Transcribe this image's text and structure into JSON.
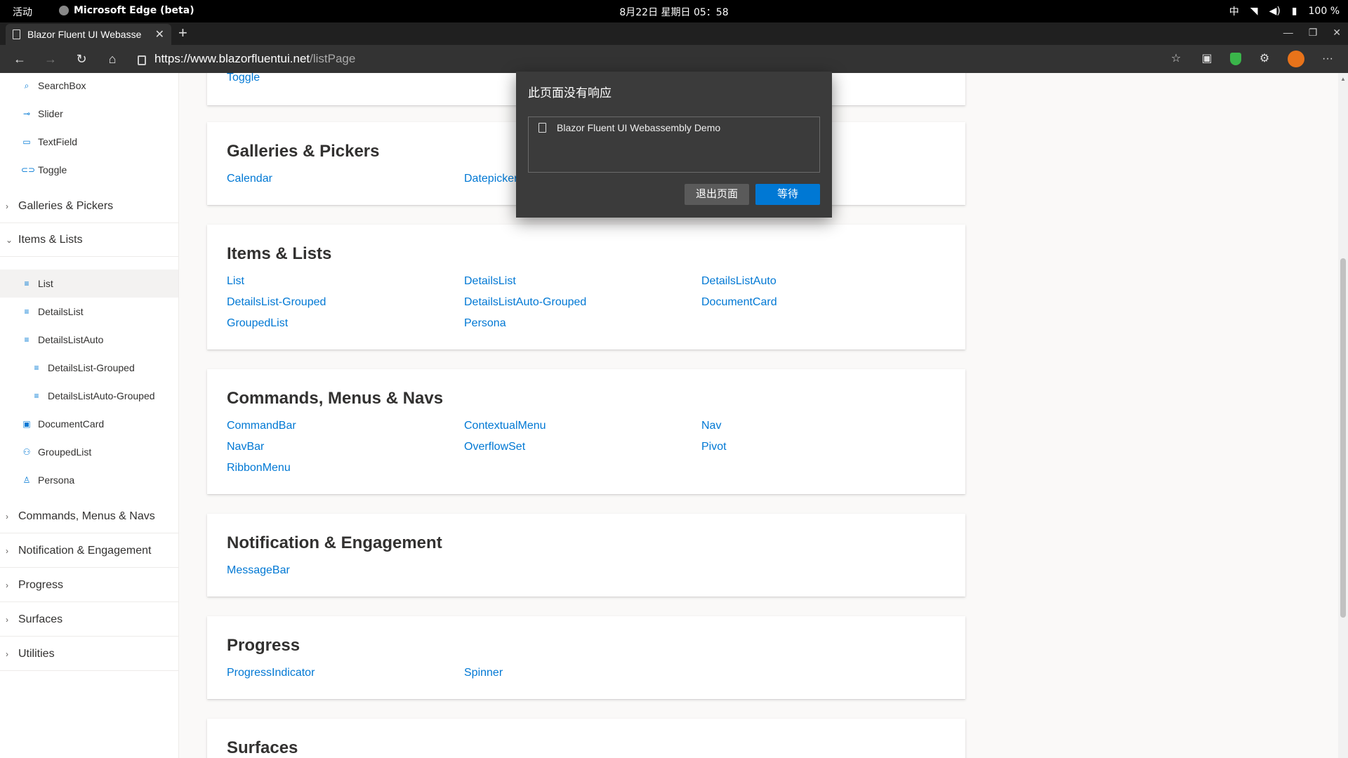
{
  "os_bar": {
    "activities": "活动",
    "app_name": "Microsoft Edge (beta)",
    "clock": "8月22日 星期日 05：58",
    "input_method": "中",
    "battery": "100 %"
  },
  "browser": {
    "tab_title": "Blazor Fluent UI Webasse",
    "url_host": "https://www.blazorfluentui.net",
    "url_path": "/listPage"
  },
  "sidebar": {
    "items_top": [
      {
        "label": "SearchBox",
        "icon": "search-icon",
        "glyph": "⌕"
      },
      {
        "label": "Slider",
        "icon": "slider-icon",
        "glyph": "⊸"
      },
      {
        "label": "TextField",
        "icon": "textfield-icon",
        "glyph": "▭"
      },
      {
        "label": "Toggle",
        "icon": "toggle-icon",
        "glyph": "⊂⊃"
      }
    ],
    "group_galleries": "Galleries & Pickers",
    "group_items": "Items & Lists",
    "items_lists": [
      {
        "label": "List",
        "icon": "list-icon",
        "glyph": "≡"
      },
      {
        "label": "DetailsList",
        "icon": "list-icon",
        "glyph": "≡"
      },
      {
        "label": "DetailsListAuto",
        "icon": "list-icon",
        "glyph": "≡"
      },
      {
        "label": "DetailsList-Grouped",
        "icon": "list-icon",
        "glyph": "≡"
      },
      {
        "label": "DetailsListAuto-Grouped",
        "icon": "list-icon",
        "glyph": "≡"
      },
      {
        "label": "DocumentCard",
        "icon": "document-card-icon",
        "glyph": "▣"
      },
      {
        "label": "GroupedList",
        "icon": "people-icon",
        "glyph": "⚇"
      },
      {
        "label": "Persona",
        "icon": "person-icon",
        "glyph": "♙"
      }
    ],
    "groups_bottom": [
      "Commands, Menus & Navs",
      "Notification & Engagement",
      "Progress",
      "Surfaces",
      "Utilities"
    ]
  },
  "main": {
    "partial_link": "Toggle",
    "sections": {
      "galleries": {
        "title": "Galleries & Pickers",
        "links": [
          "Calendar",
          "Datepicker"
        ]
      },
      "items": {
        "title": "Items & Lists",
        "links": [
          "List",
          "DetailsList",
          "DetailsListAuto",
          "DetailsList-Grouped",
          "DetailsListAuto-Grouped",
          "DocumentCard",
          "GroupedList",
          "Persona"
        ]
      },
      "commands": {
        "title": "Commands, Menus & Navs",
        "links": [
          "CommandBar",
          "ContextualMenu",
          "Nav",
          "NavBar",
          "OverflowSet",
          "Pivot",
          "RibbonMenu"
        ]
      },
      "notification": {
        "title": "Notification & Engagement",
        "links": [
          "MessageBar"
        ]
      },
      "progress": {
        "title": "Progress",
        "links": [
          "ProgressIndicator",
          "Spinner"
        ]
      },
      "surfaces": {
        "title": "Surfaces"
      }
    }
  },
  "dialog": {
    "title": "此页面没有响应",
    "page_name": "Blazor Fluent UI Webassembly Demo",
    "exit_label": "退出页面",
    "wait_label": "等待"
  }
}
